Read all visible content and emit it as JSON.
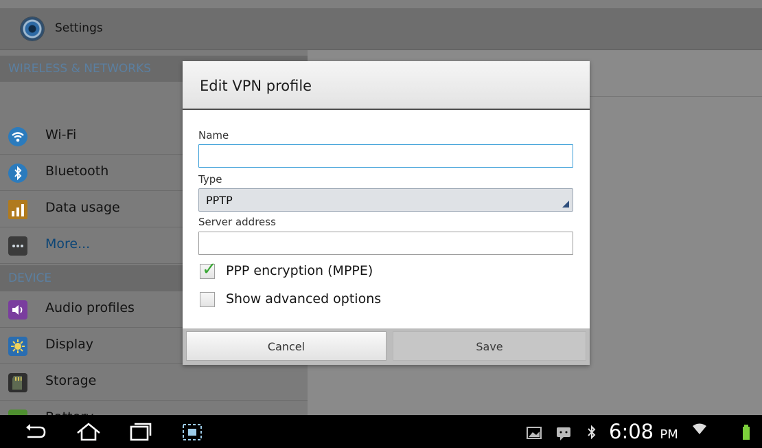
{
  "app": {
    "title": "Settings",
    "icon": "settings-gear-icon"
  },
  "sidebar": {
    "sections": [
      {
        "header": "WIRELESS & NETWORKS"
      },
      {
        "header": "DEVICE"
      }
    ],
    "items": [
      {
        "label": "Wi-Fi",
        "icon": "wifi-icon"
      },
      {
        "label": "Bluetooth",
        "icon": "bluetooth-icon"
      },
      {
        "label": "Data usage",
        "icon": "data-usage-icon"
      },
      {
        "label": "More...",
        "icon": "more-icon"
      },
      {
        "label": "Audio profiles",
        "icon": "audio-icon"
      },
      {
        "label": "Display",
        "icon": "display-icon"
      },
      {
        "label": "Storage",
        "icon": "storage-icon"
      },
      {
        "label": "Battery",
        "icon": "battery-icon"
      }
    ]
  },
  "dialog": {
    "title": "Edit VPN profile",
    "name_label": "Name",
    "name_value": "",
    "type_label": "Type",
    "type_value": "PPTP",
    "server_label": "Server address",
    "server_value": "",
    "ppp_encryption_label": "PPP encryption (MPPE)",
    "ppp_encryption_checked": true,
    "advanced_label": "Show advanced options",
    "advanced_checked": false,
    "cancel_label": "Cancel",
    "save_label": "Save"
  },
  "status_bar": {
    "time": "6:08",
    "ampm": "PM"
  },
  "colors": {
    "accent": "#3a9ed8",
    "check": "#3aa735"
  }
}
